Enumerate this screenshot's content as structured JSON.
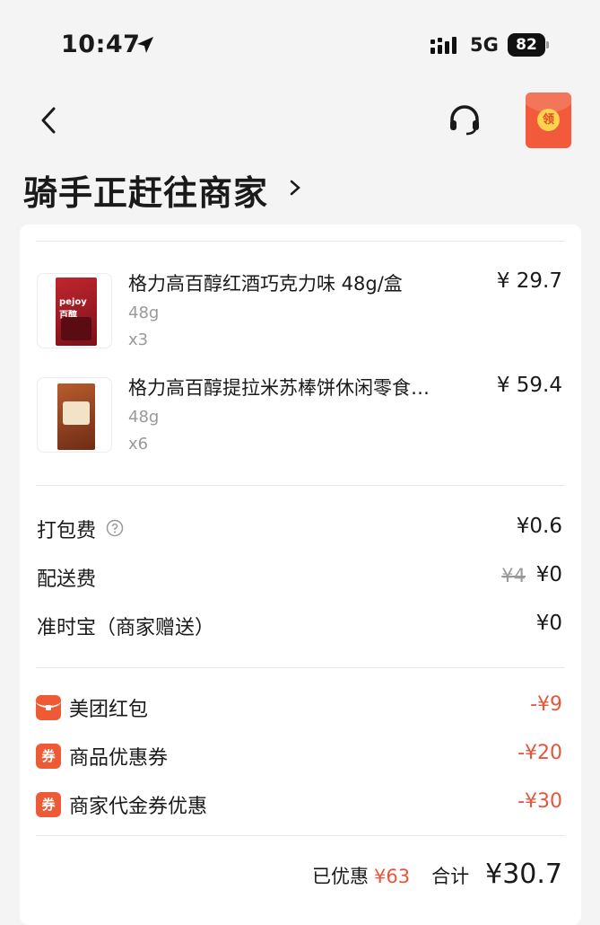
{
  "status_bar": {
    "time": "10:47",
    "network": "5G",
    "battery": "82",
    "icons": [
      "location-arrow-icon",
      "signal-icon"
    ]
  },
  "header": {
    "title": "骑手正赶往商家",
    "red_packet_seal": "领",
    "icons": [
      "back-icon",
      "headset-icon",
      "red-packet-icon",
      "chevron-right-icon"
    ]
  },
  "items": [
    {
      "name": "格力高百醇红酒巧克力味 48g/盒",
      "price": "¥ 29.7",
      "spec": "48g",
      "qty": "x3",
      "box_text": "pejoy 百醇"
    },
    {
      "name": "格力高百醇提拉米苏棒饼休闲零食…",
      "price": "¥ 59.4",
      "spec": "48g",
      "qty": "x6"
    }
  ],
  "fees": {
    "packing_label": "打包费",
    "packing_value": "¥0.6",
    "delivery_label": "配送费",
    "delivery_original": "¥4",
    "delivery_value": "¥0",
    "ontime_label": "准时宝（商家赠送）",
    "ontime_value": "¥0"
  },
  "discounts": [
    {
      "icon": "red-envelope-icon",
      "label": "美团红包",
      "value": "-¥9"
    },
    {
      "icon": "coupon-icon",
      "icon_text": "券",
      "label": "商品优惠券",
      "value": "-¥20"
    },
    {
      "icon": "coupon-icon",
      "icon_text": "券",
      "label": "商家代金券优惠",
      "value": "-¥30"
    }
  ],
  "summary": {
    "saved_label": "已优惠",
    "saved_value": "¥63",
    "total_label": "合计",
    "total_value": "¥30.7"
  },
  "colors": {
    "accent": "#e8553b",
    "background": "#f4f4f4",
    "card": "#ffffff"
  }
}
